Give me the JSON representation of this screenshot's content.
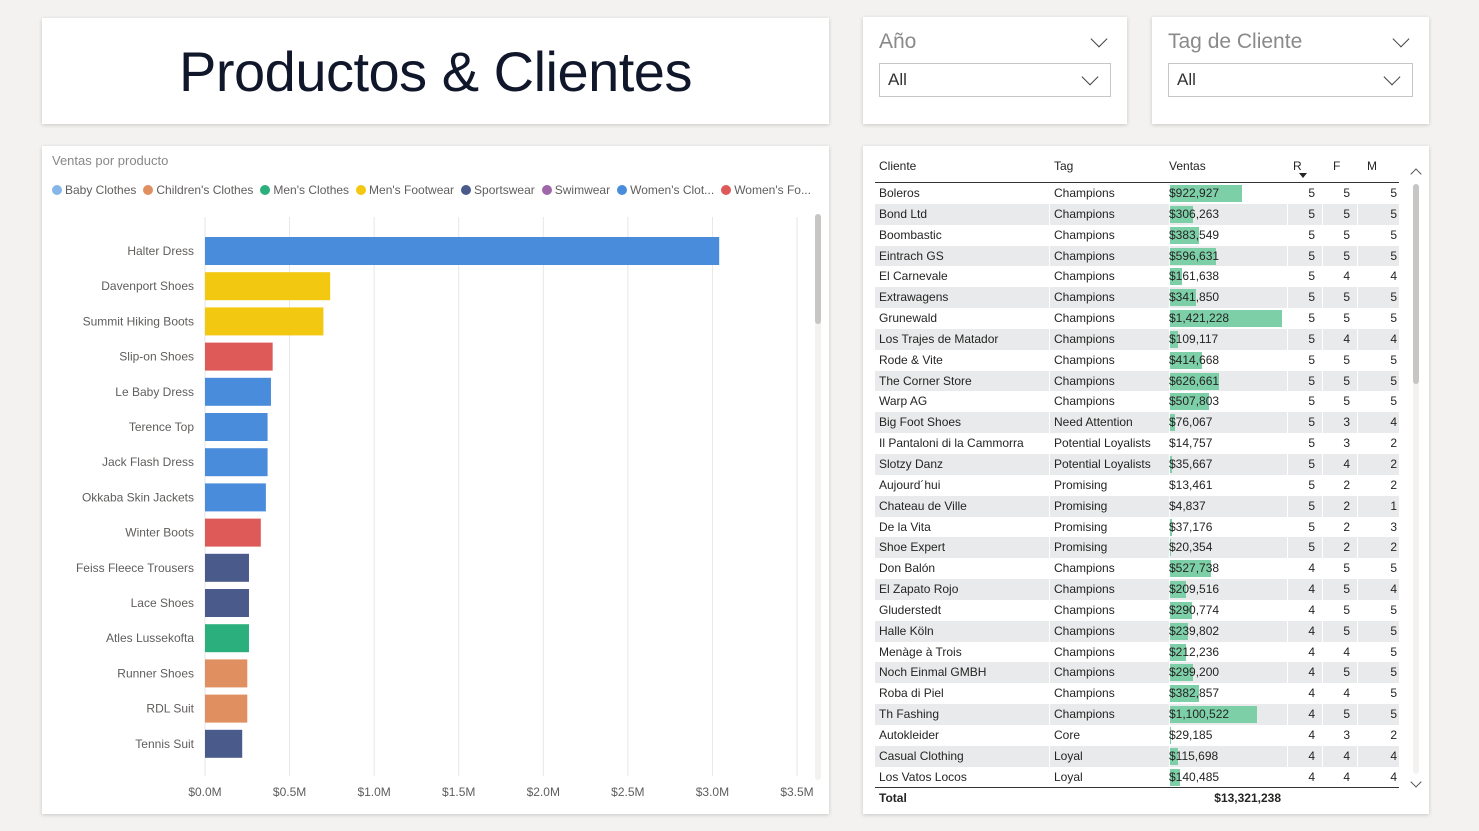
{
  "header": {
    "title": "Productos & Clientes"
  },
  "slicers": {
    "year": {
      "title": "Año",
      "value": "All"
    },
    "tag": {
      "title": "Tag de Cliente",
      "value": "All"
    }
  },
  "colors": {
    "Baby Clothes": "#86b6e8",
    "Children's Clothes": "#e09060",
    "Men's Clothes": "#2bb07d",
    "Men's Footwear": "#f2c811",
    "Sportswear": "#4a5a8a",
    "Swimwear": "#a066aa",
    "Women's Clot...": "#4a8cdc",
    "Women's Fo...": "#dd5a58",
    "table_bar": "#7dcfa8"
  },
  "chart_data": {
    "type": "bar",
    "orientation": "horizontal",
    "title": "Ventas por producto",
    "legend": [
      "Baby Clothes",
      "Children's Clothes",
      "Men's Clothes",
      "Men's Footwear",
      "Sportswear",
      "Swimwear",
      "Women's Clot...",
      "Women's Fo..."
    ],
    "legend_position": "top",
    "categories": [
      "Halter Dress",
      "Davenport Shoes",
      "Summit Hiking Boots",
      "Slip-on Shoes",
      "Le Baby Dress",
      "Terence Top",
      "Jack Flash Dress",
      "Okkaba Skin Jackets",
      "Winter Boots",
      "Feiss Fleece Trousers",
      "Lace Shoes",
      "Atles Lussekofta",
      "Runner Shoes",
      "RDL Suit",
      "Tennis Suit"
    ],
    "values": [
      3.04,
      0.74,
      0.7,
      0.4,
      0.39,
      0.37,
      0.37,
      0.36,
      0.33,
      0.26,
      0.26,
      0.26,
      0.25,
      0.25,
      0.22
    ],
    "series_of_category": [
      "Women's Clot...",
      "Men's Footwear",
      "Men's Footwear",
      "Women's Fo...",
      "Women's Clot...",
      "Women's Clot...",
      "Women's Clot...",
      "Women's Clot...",
      "Women's Fo...",
      "Sportswear",
      "Sportswear",
      "Men's Clothes",
      "Children's Clothes",
      "Children's Clothes",
      "Sportswear"
    ],
    "value_unit": "$M",
    "xlim": [
      0,
      3.5
    ],
    "x_ticks": [
      "$0.0M",
      "$0.5M",
      "$1.0M",
      "$1.5M",
      "$2.0M",
      "$2.5M",
      "$3.0M",
      "$3.5M"
    ],
    "grid": true
  },
  "table": {
    "headers": {
      "cliente": "Cliente",
      "tag": "Tag",
      "ventas": "Ventas",
      "r": "R",
      "f": "F",
      "m": "M"
    },
    "rows": [
      {
        "cliente": "Boleros",
        "tag": "Champions",
        "ventas": "$922,927",
        "v": 922927,
        "r": "5",
        "f": "5",
        "m": "5"
      },
      {
        "cliente": "Bond Ltd",
        "tag": "Champions",
        "ventas": "$306,263",
        "v": 306263,
        "r": "5",
        "f": "5",
        "m": "5"
      },
      {
        "cliente": "Boombastic",
        "tag": "Champions",
        "ventas": "$383,549",
        "v": 383549,
        "r": "5",
        "f": "5",
        "m": "5"
      },
      {
        "cliente": "Eintrach GS",
        "tag": "Champions",
        "ventas": "$596,631",
        "v": 596631,
        "r": "5",
        "f": "5",
        "m": "5"
      },
      {
        "cliente": "El Carnevale",
        "tag": "Champions",
        "ventas": "$161,638",
        "v": 161638,
        "r": "5",
        "f": "4",
        "m": "4"
      },
      {
        "cliente": "Extrawagens",
        "tag": "Champions",
        "ventas": "$341,850",
        "v": 341850,
        "r": "5",
        "f": "5",
        "m": "5"
      },
      {
        "cliente": "Grunewald",
        "tag": "Champions",
        "ventas": "$1,421,228",
        "v": 1421228,
        "r": "5",
        "f": "5",
        "m": "5"
      },
      {
        "cliente": "Los Trajes de Matador",
        "tag": "Champions",
        "ventas": "$109,117",
        "v": 109117,
        "r": "5",
        "f": "4",
        "m": "4"
      },
      {
        "cliente": "Rode & Vite",
        "tag": "Champions",
        "ventas": "$414,668",
        "v": 414668,
        "r": "5",
        "f": "5",
        "m": "5"
      },
      {
        "cliente": "The Corner Store",
        "tag": "Champions",
        "ventas": "$626,661",
        "v": 626661,
        "r": "5",
        "f": "5",
        "m": "5"
      },
      {
        "cliente": "Warp AG",
        "tag": "Champions",
        "ventas": "$507,803",
        "v": 507803,
        "r": "5",
        "f": "5",
        "m": "5"
      },
      {
        "cliente": "Big Foot Shoes",
        "tag": "Need Attention",
        "ventas": "$76,067",
        "v": 76067,
        "r": "5",
        "f": "3",
        "m": "4"
      },
      {
        "cliente": "Il Pantaloni di la Cammorra",
        "tag": "Potential Loyalists",
        "ventas": "$14,757",
        "v": 14757,
        "r": "5",
        "f": "3",
        "m": "2"
      },
      {
        "cliente": "Slotzy Danz",
        "tag": "Potential Loyalists",
        "ventas": "$35,667",
        "v": 35667,
        "r": "5",
        "f": "4",
        "m": "2"
      },
      {
        "cliente": "Aujourd´hui",
        "tag": "Promising",
        "ventas": "$13,461",
        "v": 13461,
        "r": "5",
        "f": "2",
        "m": "2"
      },
      {
        "cliente": "Chateau de Ville",
        "tag": "Promising",
        "ventas": "$4,837",
        "v": 4837,
        "r": "5",
        "f": "2",
        "m": "1"
      },
      {
        "cliente": "De la Vita",
        "tag": "Promising",
        "ventas": "$37,176",
        "v": 37176,
        "r": "5",
        "f": "2",
        "m": "3"
      },
      {
        "cliente": "Shoe Expert",
        "tag": "Promising",
        "ventas": "$20,354",
        "v": 20354,
        "r": "5",
        "f": "2",
        "m": "2"
      },
      {
        "cliente": "Don Balón",
        "tag": "Champions",
        "ventas": "$527,738",
        "v": 527738,
        "r": "4",
        "f": "5",
        "m": "5"
      },
      {
        "cliente": "El Zapato Rojo",
        "tag": "Champions",
        "ventas": "$209,516",
        "v": 209516,
        "r": "4",
        "f": "5",
        "m": "4"
      },
      {
        "cliente": "Gluderstedt",
        "tag": "Champions",
        "ventas": "$290,774",
        "v": 290774,
        "r": "4",
        "f": "5",
        "m": "5"
      },
      {
        "cliente": "Halle Köln",
        "tag": "Champions",
        "ventas": "$239,802",
        "v": 239802,
        "r": "4",
        "f": "5",
        "m": "5"
      },
      {
        "cliente": "Menàge à Trois",
        "tag": "Champions",
        "ventas": "$212,236",
        "v": 212236,
        "r": "4",
        "f": "4",
        "m": "5"
      },
      {
        "cliente": "Noch Einmal GMBH",
        "tag": "Champions",
        "ventas": "$299,200",
        "v": 299200,
        "r": "4",
        "f": "5",
        "m": "5"
      },
      {
        "cliente": "Roba di Piel",
        "tag": "Champions",
        "ventas": "$382,857",
        "v": 382857,
        "r": "4",
        "f": "4",
        "m": "5"
      },
      {
        "cliente": "Th Fashing",
        "tag": "Champions",
        "ventas": "$1,100,522",
        "v": 1100522,
        "r": "4",
        "f": "5",
        "m": "5"
      },
      {
        "cliente": "Autokleider",
        "tag": "Core",
        "ventas": "$29,185",
        "v": 29185,
        "r": "4",
        "f": "3",
        "m": "2"
      },
      {
        "cliente": "Casual Clothing",
        "tag": "Loyal",
        "ventas": "$115,698",
        "v": 115698,
        "r": "4",
        "f": "4",
        "m": "4"
      },
      {
        "cliente": "Los Vatos Locos",
        "tag": "Loyal",
        "ventas": "$140,485",
        "v": 140485,
        "r": "4",
        "f": "4",
        "m": "4"
      }
    ],
    "total": {
      "label": "Total",
      "ventas": "$13,321,238"
    }
  }
}
